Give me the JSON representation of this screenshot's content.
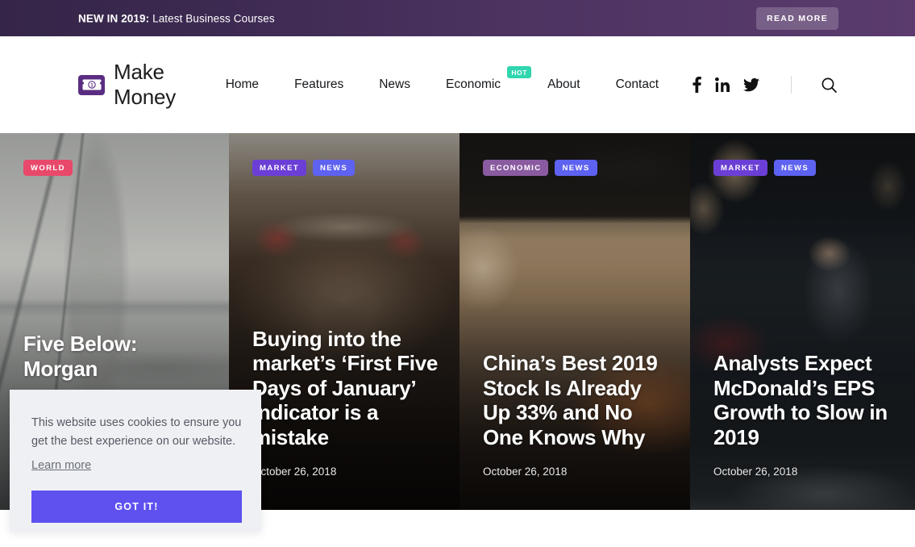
{
  "promo": {
    "strong": "NEW IN 2019:",
    "rest": " Latest Business Courses",
    "button": "READ MORE"
  },
  "header": {
    "brand": "Make Money",
    "logo_icon": "banknote-icon",
    "nav": [
      {
        "label": "Home"
      },
      {
        "label": "Features"
      },
      {
        "label": "News"
      },
      {
        "label": "Economic",
        "badge": "HOT"
      },
      {
        "label": "About"
      },
      {
        "label": "Contact"
      }
    ],
    "social": [
      {
        "name": "facebook-icon"
      },
      {
        "name": "linkedin-icon"
      },
      {
        "name": "twitter-icon"
      }
    ],
    "search_icon": "search-icon"
  },
  "colors": {
    "promo_left": "#352548",
    "promo_right": "#5b3b6e",
    "hot_badge": "#2fd6ae",
    "tag_world": "#e8496b",
    "tag_market": "#6b3fd6",
    "tag_news": "#5e62f0",
    "tag_economic": "#8a5ba0",
    "cookie_button": "#5e51f0",
    "cookie_bg": "#eff0f4"
  },
  "hero": {
    "cards": [
      {
        "tags": [
          {
            "label": "WORLD",
            "style": "world"
          }
        ],
        "title": "Five Below: Morgan",
        "date": ""
      },
      {
        "tags": [
          {
            "label": "MARKET",
            "style": "market"
          },
          {
            "label": "NEWS",
            "style": "news"
          }
        ],
        "title": "Buying into the market’s ‘First Five Days of January’ Indicator is a mistake",
        "date": "October 26, 2018"
      },
      {
        "tags": [
          {
            "label": "ECONOMIC",
            "style": "economic"
          },
          {
            "label": "NEWS",
            "style": "news"
          }
        ],
        "title": "China’s Best 2019 Stock Is Already Up 33% and No One Knows Why",
        "date": "October 26, 2018"
      },
      {
        "tags": [
          {
            "label": "MARKET",
            "style": "market"
          },
          {
            "label": "NEWS",
            "style": "news"
          }
        ],
        "title": "Analysts Expect McDonald’s EPS Growth to Slow in 2019",
        "date": "October 26, 2018"
      }
    ]
  },
  "cookie": {
    "line1": "This website uses cookies to ensure you",
    "line2": "get the best experience on our website.",
    "link": "Learn more",
    "button": "GOT IT!"
  }
}
